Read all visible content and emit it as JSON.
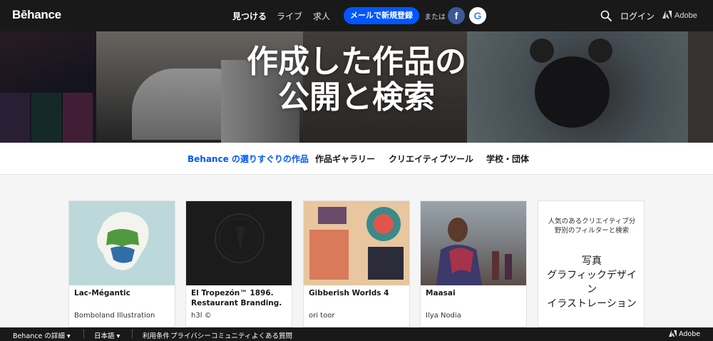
{
  "brand": {
    "name": "Bēhance"
  },
  "nav": {
    "links": [
      "見つける",
      "ライブ",
      "求人"
    ],
    "signup_label": "メールで新規登録",
    "or_label": "または",
    "facebook_glyph": "f",
    "google_glyph": "G",
    "login_label": "ログイン",
    "adobe_label": "Adobe"
  },
  "hero": {
    "title_line1": "作成した作品の",
    "title_line2": "公開と検索"
  },
  "subnav": {
    "items": [
      "Behance の選りすぐりの作品",
      "作品ギャラリー",
      "クリエイティブツール",
      "学校・団体"
    ],
    "active_index": 0
  },
  "projects": [
    {
      "title": "Lac-Mégantic",
      "owner": "Bomboland Illustration"
    },
    {
      "title": "El Tropezón™ 1896. Restaurant Branding.",
      "owner": "h3l ©"
    },
    {
      "title": "Gibberish Worlds 4",
      "owner": "ori toor"
    },
    {
      "title": "Maasai",
      "owner": "Ilya Nodia"
    }
  ],
  "filters": {
    "intro": "人気のあるクリエイティブ分野別のフィルターと検索",
    "items": [
      "写真",
      "グラフィックデザイン",
      "イラストレーション"
    ]
  },
  "footer": {
    "about": "Behance の詳細",
    "language": "日本語",
    "terms": "利用条件",
    "privacy": "プライバシー",
    "community": "コミュニティ",
    "faq": "よくある質問",
    "adobe": "Adobe"
  },
  "colors": {
    "accent": "#0057ff",
    "nav_bg": "#191919",
    "facebook": "#3b5998"
  },
  "icons": [
    "search-icon",
    "chevron-down-icon",
    "adobe-logo-icon"
  ]
}
